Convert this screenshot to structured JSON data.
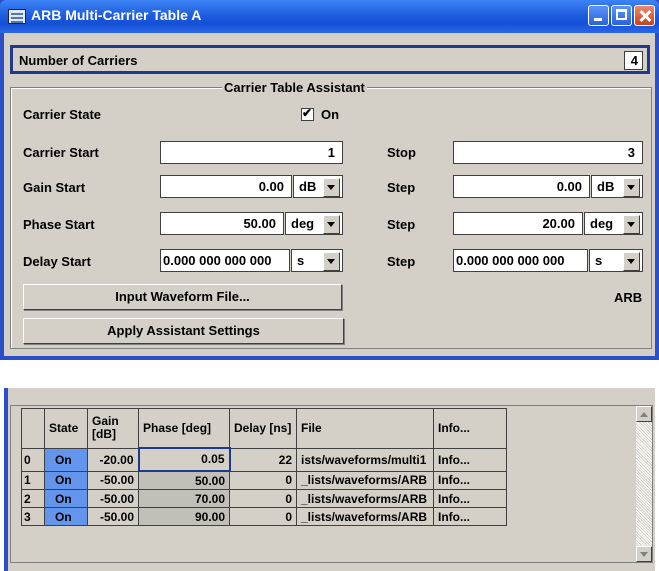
{
  "window": {
    "title": "ARB Multi-Carrier Table A"
  },
  "carriers": {
    "label": "Number of Carriers",
    "value": "4"
  },
  "assistant": {
    "title": "Carrier Table Assistant",
    "carrier_state": {
      "label": "Carrier State",
      "checkbox_label": "On",
      "checked": true
    },
    "carrier_start": {
      "label": "Carrier Start",
      "value": "1",
      "stop_label": "Stop",
      "stop_value": "3"
    },
    "gain_start": {
      "label": "Gain Start",
      "value": "0.00",
      "unit": "dB",
      "step_label": "Step",
      "step_value": "0.00",
      "step_unit": "dB"
    },
    "phase_start": {
      "label": "Phase Start",
      "value": "50.00",
      "unit": "deg",
      "step_label": "Step",
      "step_value": "20.00",
      "step_unit": "deg"
    },
    "delay_start": {
      "label": "Delay Start",
      "value": "0.000 000 000 000",
      "unit": "s",
      "step_label": "Step",
      "step_value": "0.000 000 000 000",
      "step_unit": "s"
    },
    "input_waveform_button": "Input Waveform File...",
    "waveform_file_value": "ARB",
    "apply_button": "Apply Assistant Settings"
  },
  "table": {
    "headers": {
      "state": "State",
      "gain": "Gain [dB]",
      "phase": "Phase [deg]",
      "delay": "Delay [ns]",
      "file": "File",
      "info": "Info..."
    },
    "rows": [
      {
        "index": "0",
        "state": "On",
        "gain": "-20.00",
        "phase": "0.05",
        "delay": "22",
        "file": "ists/waveforms/multi1",
        "info": "Info..."
      },
      {
        "index": "1",
        "state": "On",
        "gain": "-50.00",
        "phase": "50.00",
        "delay": "0",
        "file": "_lists/waveforms/ARB",
        "info": "Info..."
      },
      {
        "index": "2",
        "state": "On",
        "gain": "-50.00",
        "phase": "70.00",
        "delay": "0",
        "file": "_lists/waveforms/ARB",
        "info": "Info..."
      },
      {
        "index": "3",
        "state": "On",
        "gain": "-50.00",
        "phase": "90.00",
        "delay": "0",
        "file": "_lists/waveforms/ARB",
        "info": "Info..."
      }
    ]
  },
  "colors": {
    "title_bar": "#1f5ee0",
    "panel": "#d4d0c8",
    "state_cell": "#6495ed",
    "frame": "#1e3a8a"
  }
}
